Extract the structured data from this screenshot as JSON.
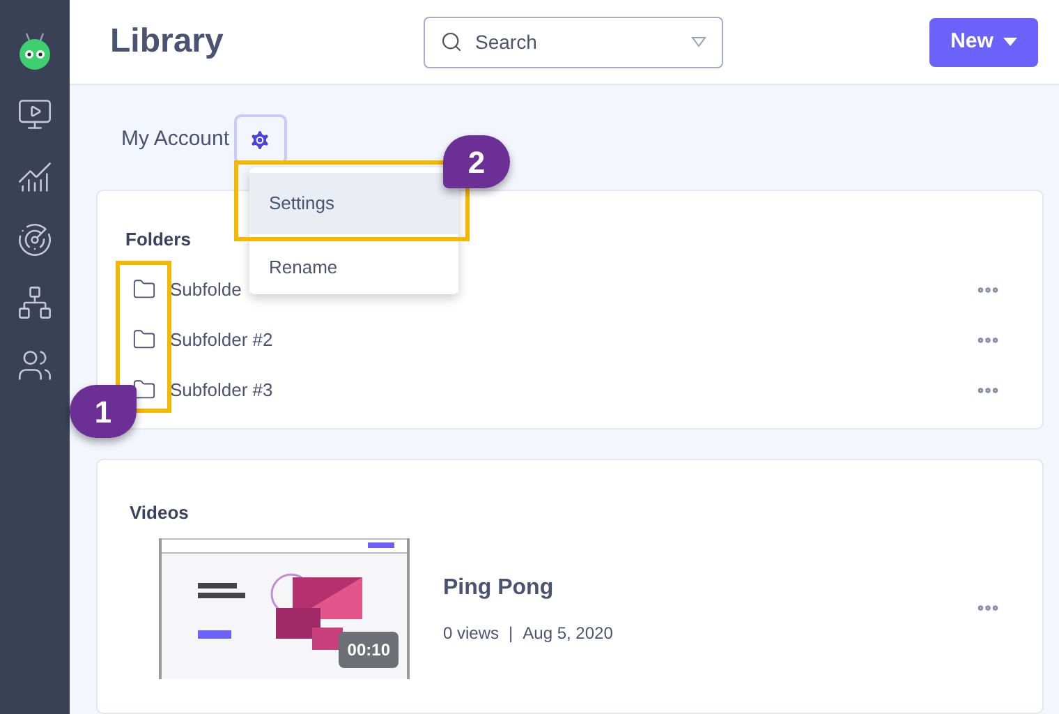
{
  "header": {
    "title": "Library",
    "search": {
      "placeholder": "Search"
    },
    "new_button": "New"
  },
  "account": {
    "label": "My Account"
  },
  "menu": {
    "items": [
      {
        "label": "Settings",
        "selected": true
      },
      {
        "label": "Rename",
        "selected": false
      }
    ]
  },
  "folders": {
    "title": "Folders",
    "items": [
      {
        "label": "Subfolde"
      },
      {
        "label": "Subfolder #2"
      },
      {
        "label": "Subfolder #3"
      }
    ]
  },
  "videos": {
    "title": "Videos",
    "items": [
      {
        "title": "Ping Pong",
        "views": "0 views",
        "separator": "|",
        "date": "Aug 5, 2020",
        "duration": "00:10"
      }
    ]
  },
  "annotations": [
    {
      "label": "1"
    },
    {
      "label": "2"
    }
  ]
}
